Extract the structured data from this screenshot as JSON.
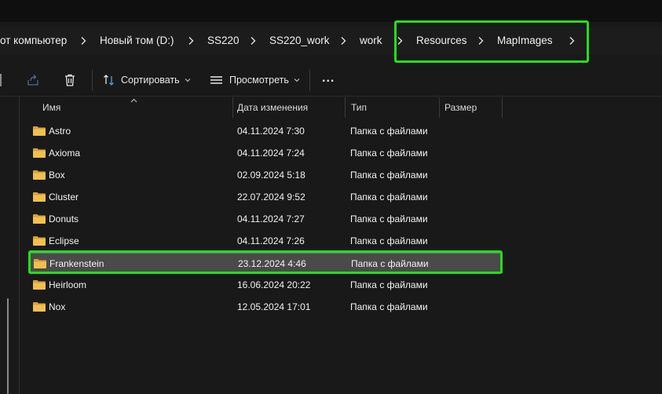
{
  "breadcrumb": {
    "items": [
      "от компьютер",
      "Новый том (D:)",
      "SS220",
      "SS220_work",
      "work",
      "Resources",
      "MapImages"
    ]
  },
  "toolbar": {
    "sort_label": "Сортировать",
    "view_label": "Просмотреть",
    "more_label": "..."
  },
  "columns": {
    "name": "Имя",
    "date": "Дата изменения",
    "type": "Тип",
    "size": "Размер"
  },
  "files": [
    {
      "name": "Astro",
      "date": "04.11.2024 7:30",
      "type": "Папка с файлами"
    },
    {
      "name": "Axioma",
      "date": "04.11.2024 7:24",
      "type": "Папка с файлами"
    },
    {
      "name": "Box",
      "date": "02.09.2024 5:18",
      "type": "Папка с файлами"
    },
    {
      "name": "Cluster",
      "date": "22.07.2024 9:52",
      "type": "Папка с файлами"
    },
    {
      "name": "Donuts",
      "date": "04.11.2024 7:27",
      "type": "Папка с файлами"
    },
    {
      "name": "Eclipse",
      "date": "04.11.2024 7:26",
      "type": "Папка с файлами"
    },
    {
      "name": "Frankenstein",
      "date": "23.12.2024 4:46",
      "type": "Папка с файлами"
    },
    {
      "name": "Heirloom",
      "date": "16.06.2024 20:22",
      "type": "Папка с файлами"
    },
    {
      "name": "Nox",
      "date": "12.05.2024 17:01",
      "type": "Папка с файлами"
    }
  ],
  "selected_file": "Frankenstein",
  "colors": {
    "highlight": "#22e01a",
    "folder": "#e8b33a",
    "background": "#191919",
    "selected_row": "#4a4a4a"
  }
}
